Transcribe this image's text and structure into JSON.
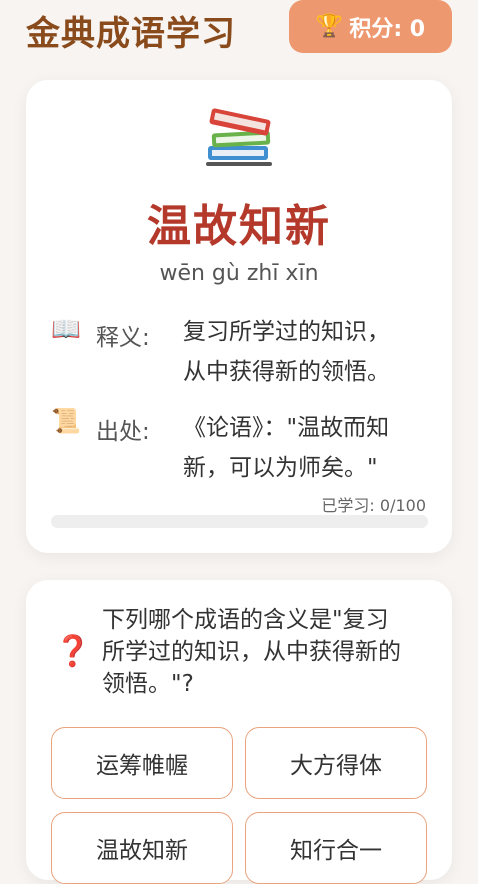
{
  "header": {
    "title": "金典成语学习",
    "score_label": "积分: 0",
    "trophy_icon": "trophy-icon"
  },
  "idiom_card": {
    "icon": "books-icon",
    "idiom": "温故知新",
    "pinyin": "wēn gù zhī xīn",
    "meaning": {
      "icon": "open-book-icon",
      "label": "释义:",
      "lines": [
        "复习所学过的知识，",
        "从中获得新的领悟。"
      ]
    },
    "source": {
      "icon": "scroll-icon",
      "label": "出处:",
      "lines": [
        "《论语》：\"温故而知",
        "新，可以为师矣。\""
      ]
    },
    "progress": {
      "label": "已学习: 0/100",
      "learned": 0,
      "total": 100
    }
  },
  "quiz": {
    "icon": "question-mark-icon",
    "question_lines": [
      "下列哪个成语的含义是\"复习",
      "所学过的知识，从中获得新的",
      "领悟。\"?"
    ],
    "options": [
      "运筹帷幄",
      "大方得体",
      "温故知新",
      "知行合一"
    ]
  },
  "colors": {
    "accent": "#ee9870",
    "title": "#8a4b1c",
    "idiom": "#b4392b",
    "background": "#f7f4f1"
  }
}
